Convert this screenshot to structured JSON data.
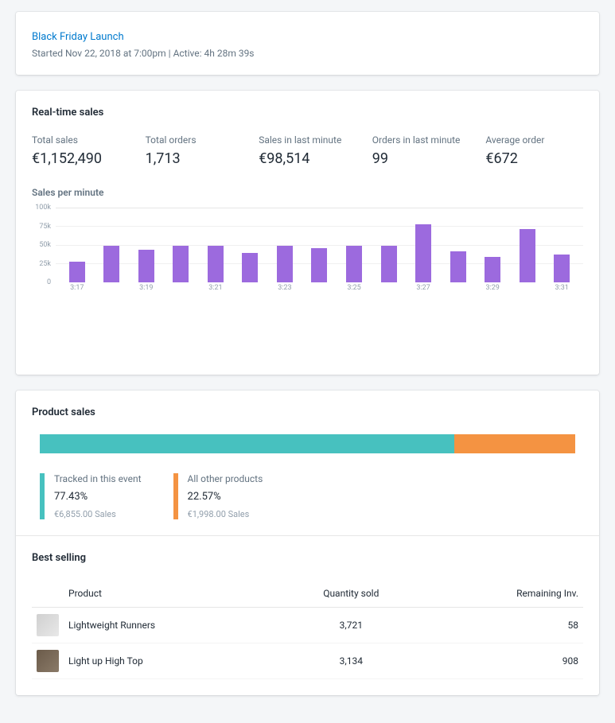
{
  "header": {
    "event_name": "Black Friday Launch",
    "meta": "Started Nov 22, 2018 at 7:00pm | Active: 4h 28m 39s"
  },
  "realtime": {
    "title": "Real-time sales",
    "stats": [
      {
        "label": "Total sales",
        "value": "€1,152,490"
      },
      {
        "label": "Total orders",
        "value": "1,713"
      },
      {
        "label": "Sales in last minute",
        "value": "€98,514"
      },
      {
        "label": "Orders in last minute",
        "value": "99"
      },
      {
        "label": "Average order",
        "value": "€672"
      }
    ],
    "chart_title": "Sales per minute"
  },
  "chart_data": {
    "type": "bar",
    "title": "Sales per minute",
    "xlabel": "",
    "ylabel": "",
    "ylim": [
      0,
      100000
    ],
    "y_ticks": [
      "0",
      "25k",
      "50k",
      "75k",
      "100k"
    ],
    "categories": [
      "3:17",
      "3:18",
      "3:19",
      "3:20",
      "3:21",
      "3:22",
      "3:23",
      "3:24",
      "3:25",
      "3:26",
      "3:27",
      "3:28",
      "3:29",
      "3:30",
      "3:31"
    ],
    "x_tick_labels": [
      "3:17",
      "",
      "3:19",
      "",
      "3:21",
      "",
      "3:23",
      "",
      "3:25",
      "",
      "3:27",
      "",
      "3:29",
      "",
      "3:31"
    ],
    "values": [
      28000,
      50000,
      44000,
      50000,
      50000,
      40000,
      50000,
      46000,
      50000,
      50000,
      78000,
      42000,
      34000,
      72000,
      38000
    ]
  },
  "product_sales": {
    "title": "Product sales",
    "segments": [
      {
        "label": "Tracked in this event",
        "pct": "77.43%",
        "sales": "€6,855.00 Sales",
        "color": "#47c1bf",
        "width": 77.43
      },
      {
        "label": "All other products",
        "pct": "22.57%",
        "sales": "€1,998.00 Sales",
        "color": "#f49342",
        "width": 22.57
      }
    ]
  },
  "best": {
    "title": "Best selling",
    "columns": {
      "product": "Product",
      "qty": "Quantity sold",
      "inv": "Remaining Inv."
    },
    "rows": [
      {
        "name": "Lightweight Runners",
        "qty": "3,721",
        "inv": "58"
      },
      {
        "name": "Light up High Top",
        "qty": "3,134",
        "inv": "908"
      }
    ]
  }
}
